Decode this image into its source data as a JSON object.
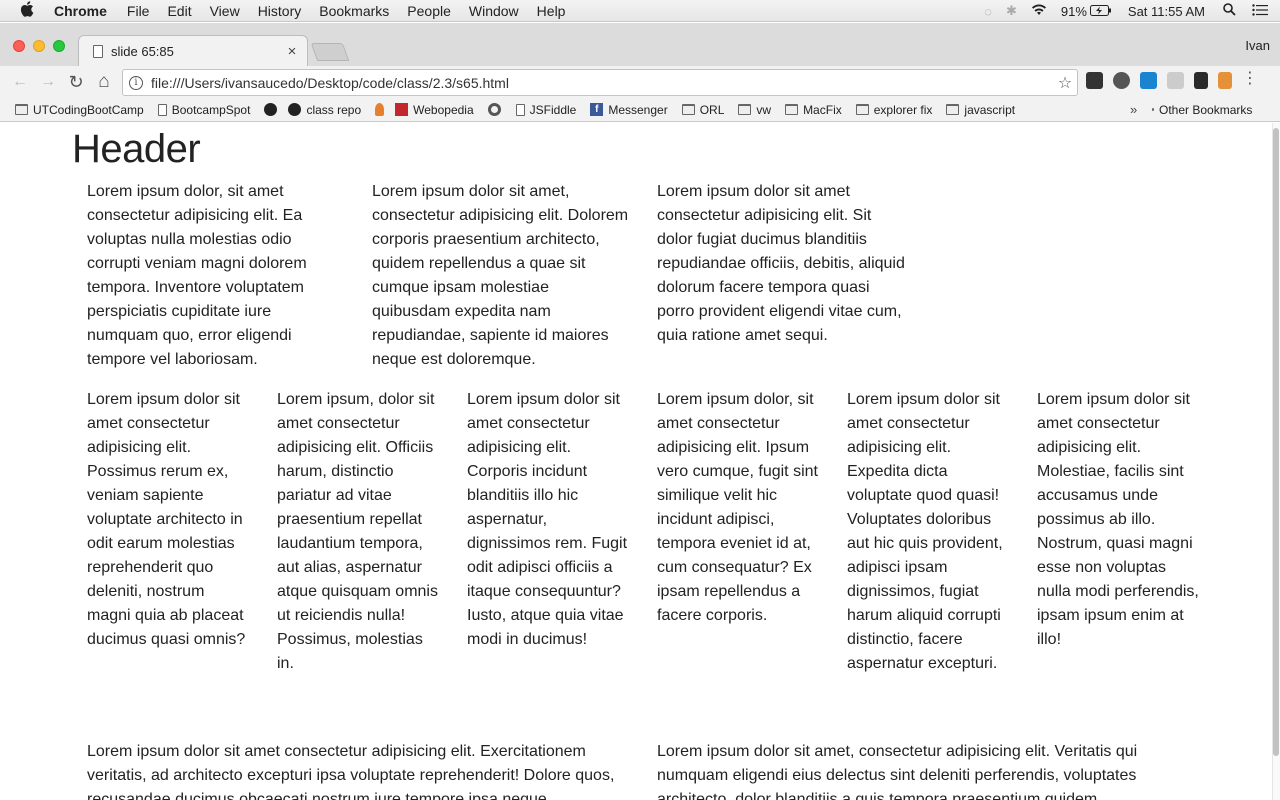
{
  "menubar": {
    "app": "Chrome",
    "items": [
      "File",
      "Edit",
      "View",
      "History",
      "Bookmarks",
      "People",
      "Window",
      "Help"
    ],
    "battery": "91%",
    "clock": "Sat 11:55 AM"
  },
  "tab": {
    "title": "slide 65:85",
    "close": "×"
  },
  "profile": "Ivan",
  "toolbar": {
    "back": "←",
    "forward": "→",
    "reload": "↻",
    "home": "⌂",
    "info": "i",
    "url": "file:///Users/ivansaucedo/Desktop/code/class/2.3/s65.html",
    "star": "☆"
  },
  "bookmarks": [
    {
      "label": "UTCodingBootCamp",
      "icon": "folder-icon"
    },
    {
      "label": "BootcampSpot",
      "icon": "page-icon"
    },
    {
      "label": "",
      "icon": "github-icon"
    },
    {
      "label": "class repo",
      "icon": "github-icon"
    },
    {
      "label": "",
      "icon": "stackoverflow-icon"
    },
    {
      "label": "Webopedia",
      "icon": "webopedia-icon"
    },
    {
      "label": "",
      "icon": "target-icon"
    },
    {
      "label": "JSFiddle",
      "icon": "page-icon"
    },
    {
      "label": "Messenger",
      "icon": "facebook-icon"
    },
    {
      "label": "ORL",
      "icon": "folder-icon"
    },
    {
      "label": "vw",
      "icon": "folder-icon"
    },
    {
      "label": "MacFix",
      "icon": "folder-icon"
    },
    {
      "label": "explorer fix",
      "icon": "folder-icon"
    },
    {
      "label": "javascript",
      "icon": "folder-icon"
    }
  ],
  "bookmarks_more": "»",
  "bookmarks_other": "Other Bookmarks",
  "page": {
    "header": "Header",
    "row1": [
      "Lorem ipsum dolor, sit amet consectetur adipisicing elit. Ea voluptas nulla molestias odio corrupti veniam magni dolorem tempora. Inventore voluptatem perspiciatis cupiditate iure numquam quo, error eligendi tempore vel laboriosam.",
      "Lorem ipsum dolor sit amet, consectetur adipisicing elit. Dolorem corporis praesentium architecto, quidem repellendus a quae sit cumque ipsam molestiae quibusdam expedita nam repudiandae, sapiente id maiores neque est doloremque.",
      "Lorem ipsum dolor sit amet consectetur adipisicing elit. Sit dolor fugiat ducimus blanditiis repudiandae officiis, debitis, aliquid dolorum facere tempora quasi porro provident eligendi vitae cum, quia ratione amet sequi."
    ],
    "row2": [
      "Lorem ipsum dolor sit amet consectetur adipisicing elit. Possimus rerum ex, veniam sapiente voluptate architecto in odit earum molestias reprehenderit quo deleniti, nostrum magni quia ab placeat ducimus quasi omnis?",
      "Lorem ipsum, dolor sit amet consectetur adipisicing elit. Officiis harum, distinctio pariatur ad vitae praesentium repellat laudantium tempora, aut alias, aspernatur atque quisquam omnis ut reiciendis nulla! Possimus, molestias in.",
      "Lorem ipsum dolor sit amet consectetur adipisicing elit. Corporis incidunt blanditiis illo hic aspernatur, dignissimos rem. Fugit odit adipisci officiis a itaque consequuntur? Iusto, atque quia vitae modi in ducimus!",
      "Lorem ipsum dolor, sit amet consectetur adipisicing elit. Ipsum vero cumque, fugit sint similique velit hic incidunt adipisci, tempora eveniet id at, cum consequatur? Ex ipsam repellendus a facere corporis.",
      "Lorem ipsum dolor sit amet consectetur adipisicing elit. Expedita dicta voluptate quod quasi! Voluptates doloribus aut hic quis provident, adipisci ipsam dignissimos, fugiat harum aliquid corrupti distinctio, facere aspernatur excepturi.",
      "Lorem ipsum dolor sit amet consectetur adipisicing elit. Molestiae, facilis sint accusamus unde possimus ab illo. Nostrum, quasi magni esse non voluptas nulla modi perferendis, ipsam ipsum enim at illo!"
    ],
    "row3": [
      "Lorem ipsum dolor sit amet consectetur adipisicing elit. Exercitationem veritatis, ad architecto excepturi ipsa voluptate reprehenderit! Dolore quos, recusandae ducimus obcaecati nostrum iure tempore ipsa neque",
      "Lorem ipsum dolor sit amet, consectetur adipisicing elit. Veritatis qui numquam eligendi eius delectus sint deleniti perferendis, voluptates architecto, dolor blanditiis a quis tempora praesentium quidem"
    ]
  }
}
